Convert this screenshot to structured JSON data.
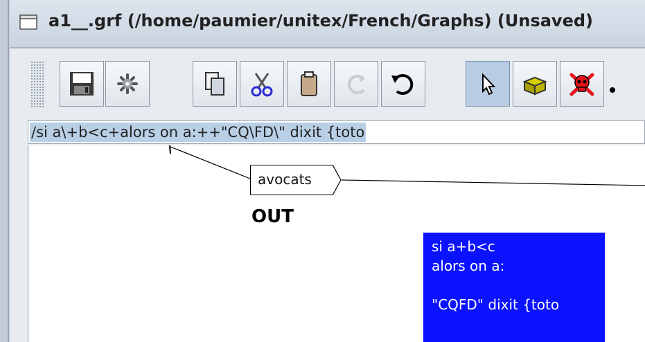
{
  "window": {
    "title": "a1__.grf (/home/paumier/unitex/French/Graphs) (Unsaved)"
  },
  "toolbar": {
    "buttons": [
      {
        "name": "save",
        "icon": "save-icon"
      },
      {
        "name": "compile",
        "icon": "gear-icon"
      },
      {
        "name": "copy",
        "icon": "copy-icon"
      },
      {
        "name": "cut",
        "icon": "scissors-icon"
      },
      {
        "name": "paste",
        "icon": "clipboard-icon"
      },
      {
        "name": "redo",
        "icon": "redo-icon"
      },
      {
        "name": "undo",
        "icon": "undo-icon"
      },
      {
        "name": "select",
        "icon": "arrow-pointer-icon"
      },
      {
        "name": "open-box",
        "icon": "open-box-icon"
      },
      {
        "name": "kill-box",
        "icon": "skull-icon"
      }
    ]
  },
  "text_field": {
    "value": "/si a\\+b<c+alors on a:++\"CQ\\FD\\\" dixit {toto"
  },
  "graph": {
    "box_label": "avocats",
    "output_label": "OUT",
    "comment_lines": [
      "si a+b<c",
      "alors on a:",
      "",
      "\"CQFD\" dixit {toto"
    ]
  },
  "colors": {
    "comment_bg": "#0a12ff",
    "selection": "#b9cfe6",
    "active_tool": "#b8cde3",
    "skull": "#e8141c"
  }
}
